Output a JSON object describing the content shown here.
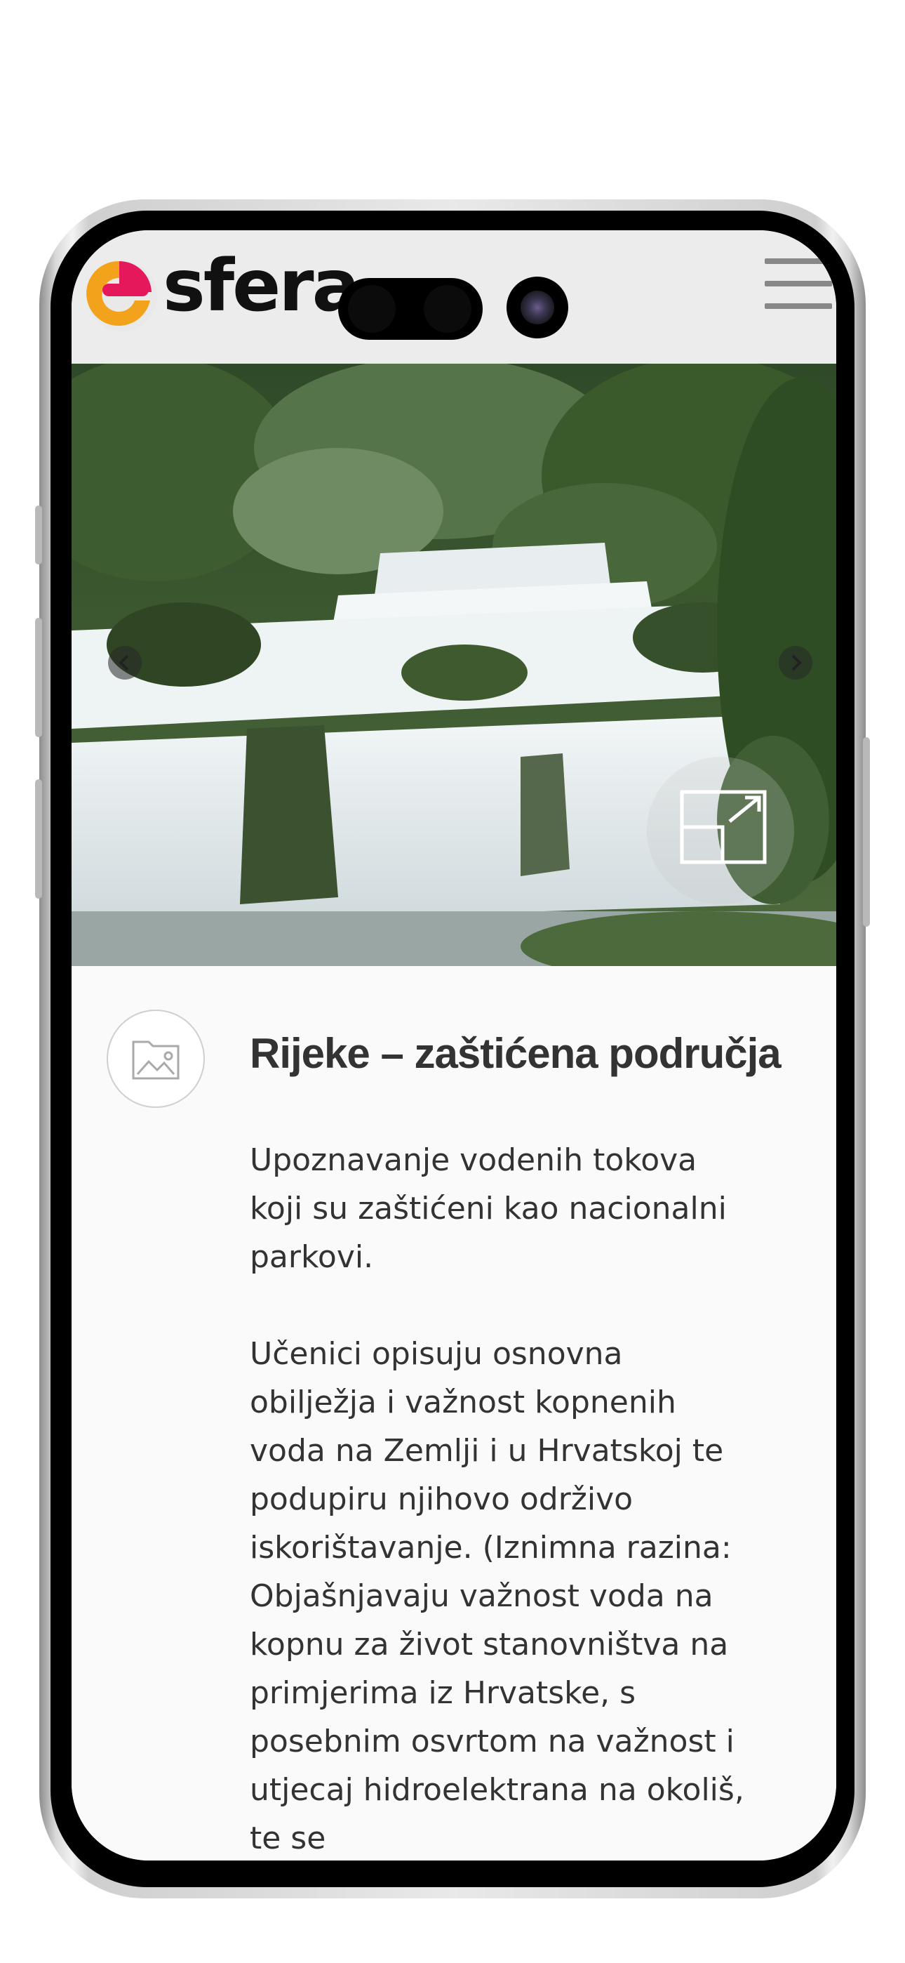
{
  "header": {
    "brand": "sfera",
    "colors": {
      "brand_orange": "#f3a21c",
      "brand_magenta": "#e6185c"
    }
  },
  "hero": {
    "image_alt": "Waterfall cascades in a national park",
    "controls": {
      "prev_icon": "chevron-left-icon",
      "next_icon": "chevron-right-icon",
      "fullscreen_icon": "expand-icon"
    }
  },
  "lesson": {
    "icon": "image-placeholder-icon",
    "title": "Rijeke – zaštićena područja",
    "intro": "Upoznavanje vodenih tokova koji su zaštićeni kao nacionalni parkovi.",
    "body": "Učenici opisuju osnovna obilježja i važnost kopnenih voda na Zemlji i u Hrvatskoj te podupiru njihovo održivo iskorištavanje. (Iznimna razina: Objašnjavaju važnost voda na kopnu za život stanovništva na primjerima iz Hrvatske, s posebnim osvrtom na važnost i utjecaj hidroelektrana na okoliš, te se"
  }
}
